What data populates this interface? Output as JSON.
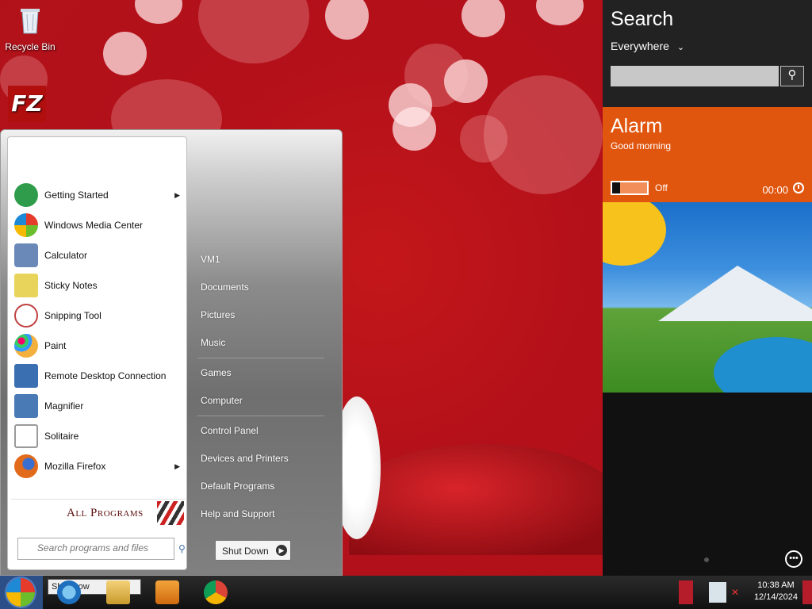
{
  "desktop": {
    "icons": [
      {
        "label": "Recycle Bin"
      },
      {
        "label": "FZ"
      }
    ]
  },
  "start_menu": {
    "programs": [
      {
        "label": "Getting Started",
        "icon": "getting-started-icon",
        "submenu": true,
        "color": "#2e9c4a"
      },
      {
        "label": "Windows Media Center",
        "icon": "media-center-icon",
        "submenu": false,
        "color": "#3f8a2f"
      },
      {
        "label": "Calculator",
        "icon": "calculator-icon",
        "submenu": false,
        "color": "#6a88b8"
      },
      {
        "label": "Sticky Notes",
        "icon": "sticky-notes-icon",
        "submenu": false,
        "color": "#e8d45a"
      },
      {
        "label": "Snipping Tool",
        "icon": "snipping-tool-icon",
        "submenu": false,
        "color": "#c04040"
      },
      {
        "label": "Paint",
        "icon": "paint-icon",
        "submenu": false,
        "color": "#d08a2a"
      },
      {
        "label": "Remote Desktop Connection",
        "icon": "remote-desktop-icon",
        "submenu": false,
        "color": "#3a6fb2"
      },
      {
        "label": "Magnifier",
        "icon": "magnifier-icon",
        "submenu": false,
        "color": "#4a7ab6"
      },
      {
        "label": "Solitaire",
        "icon": "solitaire-icon",
        "submenu": false,
        "color": "#9a9a9a"
      },
      {
        "label": "Mozilla Firefox",
        "icon": "firefox-icon",
        "submenu": true,
        "color": "#e26a1b"
      }
    ],
    "all_programs": "All Programs",
    "search_placeholder": "Search programs and files",
    "places": [
      {
        "label": "VM1"
      },
      {
        "label": "Documents"
      },
      {
        "label": "Pictures"
      },
      {
        "label": "Music"
      },
      {
        "label": "Games"
      },
      {
        "label": "Computer"
      },
      {
        "label": "Control Panel"
      },
      {
        "label": "Devices and Printers"
      },
      {
        "label": "Default Programs"
      },
      {
        "label": "Help and Support"
      }
    ],
    "shutdown_label": "Shut Down"
  },
  "charms": {
    "title": "Search",
    "scope": "Everywhere",
    "alarm": {
      "title": "Alarm",
      "greeting": "Good morning",
      "state": "Off",
      "time": "00:00"
    }
  },
  "taskbar": {
    "shutdown_mini": "Shut Dow",
    "clock_time": "10:38 AM",
    "clock_date": "12/14/2024"
  },
  "colors": {
    "alarm_tile": "#e1560f",
    "wallpaper": "#c4171a"
  }
}
